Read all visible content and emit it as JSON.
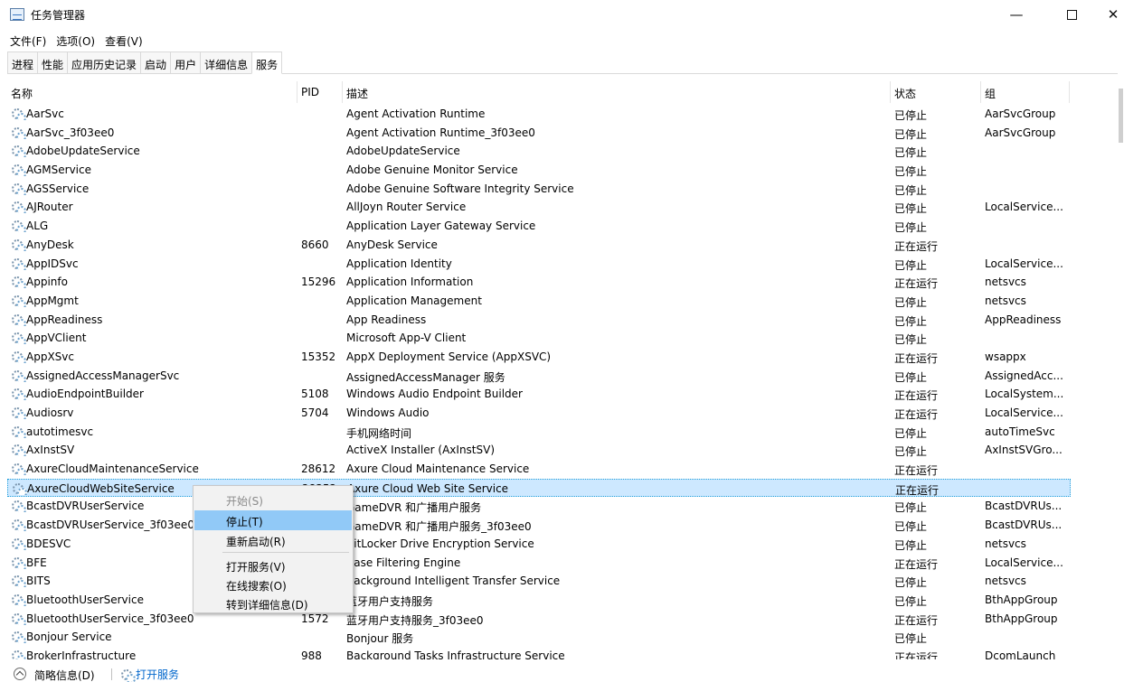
{
  "window": {
    "title": "任务管理器",
    "controls": {
      "minimize": "—",
      "close": "✕"
    }
  },
  "menu": [
    "文件(F)",
    "选项(O)",
    "查看(V)"
  ],
  "tabs": [
    "进程",
    "性能",
    "应用历史记录",
    "启动",
    "用户",
    "详细信息",
    "服务"
  ],
  "active_tab": "服务",
  "columns": {
    "name": "名称",
    "pid": "PID",
    "desc": "描述",
    "status": "状态",
    "group": "组"
  },
  "sort": {
    "column": "名称",
    "direction": "ascending",
    "indicator": "^"
  },
  "rows": [
    {
      "name": "AarSvc",
      "pid": "",
      "desc": "Agent Activation Runtime",
      "status": "已停止",
      "group": "AarSvcGroup"
    },
    {
      "name": "AarSvc_3f03ee0",
      "pid": "",
      "desc": "Agent Activation Runtime_3f03ee0",
      "status": "已停止",
      "group": "AarSvcGroup"
    },
    {
      "name": "AdobeUpdateService",
      "pid": "",
      "desc": "AdobeUpdateService",
      "status": "已停止",
      "group": ""
    },
    {
      "name": "AGMService",
      "pid": "",
      "desc": "Adobe Genuine Monitor Service",
      "status": "已停止",
      "group": ""
    },
    {
      "name": "AGSService",
      "pid": "",
      "desc": "Adobe Genuine Software Integrity Service",
      "status": "已停止",
      "group": ""
    },
    {
      "name": "AJRouter",
      "pid": "",
      "desc": "AllJoyn Router Service",
      "status": "已停止",
      "group": "LocalService..."
    },
    {
      "name": "ALG",
      "pid": "",
      "desc": "Application Layer Gateway Service",
      "status": "已停止",
      "group": ""
    },
    {
      "name": "AnyDesk",
      "pid": "8660",
      "desc": "AnyDesk Service",
      "status": "正在运行",
      "group": ""
    },
    {
      "name": "AppIDSvc",
      "pid": "",
      "desc": "Application Identity",
      "status": "已停止",
      "group": "LocalService..."
    },
    {
      "name": "Appinfo",
      "pid": "15296",
      "desc": "Application Information",
      "status": "正在运行",
      "group": "netsvcs"
    },
    {
      "name": "AppMgmt",
      "pid": "",
      "desc": "Application Management",
      "status": "已停止",
      "group": "netsvcs"
    },
    {
      "name": "AppReadiness",
      "pid": "",
      "desc": "App Readiness",
      "status": "已停止",
      "group": "AppReadiness"
    },
    {
      "name": "AppVClient",
      "pid": "",
      "desc": "Microsoft App-V Client",
      "status": "已停止",
      "group": ""
    },
    {
      "name": "AppXSvc",
      "pid": "15352",
      "desc": "AppX Deployment Service (AppXSVC)",
      "status": "正在运行",
      "group": "wsappx"
    },
    {
      "name": "AssignedAccessManagerSvc",
      "pid": "",
      "desc": "AssignedAccessManager 服务",
      "status": "已停止",
      "group": "AssignedAcc..."
    },
    {
      "name": "AudioEndpointBuilder",
      "pid": "5108",
      "desc": "Windows Audio Endpoint Builder",
      "status": "正在运行",
      "group": "LocalSystem..."
    },
    {
      "name": "Audiosrv",
      "pid": "5704",
      "desc": "Windows Audio",
      "status": "正在运行",
      "group": "LocalService..."
    },
    {
      "name": "autotimesvc",
      "pid": "",
      "desc": "手机网络时间",
      "status": "已停止",
      "group": "autoTimeSvc"
    },
    {
      "name": "AxInstSV",
      "pid": "",
      "desc": "ActiveX Installer (AxInstSV)",
      "status": "已停止",
      "group": "AxInstSVGro..."
    },
    {
      "name": "AxureCloudMaintenanceService",
      "pid": "28612",
      "desc": "Axure Cloud Maintenance Service",
      "status": "正在运行",
      "group": ""
    },
    {
      "name": "AxureCloudWebSiteService",
      "pid": "28352",
      "desc": "Axure Cloud Web Site Service",
      "status": "正在运行",
      "group": ""
    },
    {
      "name": "BcastDVRUserService",
      "pid": "",
      "desc": "GameDVR 和广播用户服务",
      "status": "已停止",
      "group": "BcastDVRUs..."
    },
    {
      "name": "BcastDVRUserService_3f03ee0",
      "pid": "",
      "desc": "GameDVR 和广播用户服务_3f03ee0",
      "status": "已停止",
      "group": "BcastDVRUs..."
    },
    {
      "name": "BDESVC",
      "pid": "",
      "desc": "BitLocker Drive Encryption Service",
      "status": "已停止",
      "group": "netsvcs"
    },
    {
      "name": "BFE",
      "pid": "",
      "desc": "Base Filtering Engine",
      "status": "正在运行",
      "group": "LocalService..."
    },
    {
      "name": "BITS",
      "pid": "",
      "desc": "Background Intelligent Transfer Service",
      "status": "已停止",
      "group": "netsvcs"
    },
    {
      "name": "BluetoothUserService",
      "pid": "",
      "desc": "蓝牙用户支持服务",
      "status": "已停止",
      "group": "BthAppGroup"
    },
    {
      "name": "BluetoothUserService_3f03ee0",
      "pid": "1572",
      "desc": "蓝牙用户支持服务_3f03ee0",
      "status": "正在运行",
      "group": "BthAppGroup"
    },
    {
      "name": "Bonjour Service",
      "pid": "",
      "desc": "Bonjour 服务",
      "status": "已停止",
      "group": ""
    },
    {
      "name": "BrokerInfrastructure",
      "pid": "988",
      "desc": "Background Tasks Infrastructure Service",
      "status": "正在运行",
      "group": "DcomLaunch"
    }
  ],
  "selected_row": "AxureCloudWebSiteService",
  "context_menu": {
    "start": "开始(S)",
    "stop": "停止(T)",
    "restart": "重新启动(R)",
    "open_services": "打开服务(V)",
    "search_online": "在线搜索(O)",
    "go_to_details": "转到详细信息(D)"
  },
  "footer": {
    "fewer_details": "简略信息(D)",
    "open_services": "打开服务"
  }
}
